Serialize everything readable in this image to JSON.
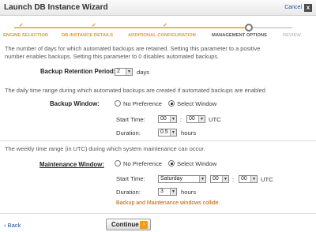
{
  "window": {
    "title": "Launch DB Instance Wizard",
    "cancel_label": "Cancel",
    "close_glyph": "x"
  },
  "steps": [
    {
      "label": "ENGINE SELECTION",
      "state": "done"
    },
    {
      "label": "DB INSTANCE DETAILS",
      "state": "done"
    },
    {
      "label": "ADDITIONAL CONFIGURATION",
      "state": "done"
    },
    {
      "label": "MANAGEMENT OPTIONS",
      "state": "current"
    },
    {
      "label": "REVIEW",
      "state": "upcoming"
    }
  ],
  "retention": {
    "description_line1": "The number of days for which automated backups are retained. Setting this parameter to a positive",
    "description_line2": "number enables backups. Setting this parameter to 0 disables automated backups.",
    "label": "Backup Retention Period:",
    "value": "2",
    "unit": "days"
  },
  "backup_window": {
    "description": "The daily time range during which automated backups are created if automated backups are enabled",
    "label": "Backup Window:",
    "option_no_pref": "No Preference",
    "option_select": "Select Window",
    "selected": "select",
    "start_time_label": "Start Time:",
    "start_hour": "00",
    "start_minute": "00",
    "time_sep": ":",
    "timezone": "UTC",
    "duration_label": "Duration:",
    "duration_value": "0.5",
    "duration_unit": "hours"
  },
  "maintenance_window": {
    "description": "The weekly time range (in UTC) during which system maintenance can occur.",
    "label": "Maintenance Window:",
    "option_no_pref": "No Preference",
    "option_select": "Select Window",
    "selected": "select",
    "start_time_label": "Start Time:",
    "start_day": "Saturday",
    "start_hour": "00",
    "start_minute": "00",
    "time_sep": ":",
    "timezone": "UTC",
    "duration_label": "Duration:",
    "duration_value": "3",
    "duration_unit": "hours",
    "warning": "Backup and Maintenance windows collide."
  },
  "footer": {
    "back_label": "Back",
    "back_glyph": "‹",
    "continue_label": "Continue",
    "continue_glyph": "›"
  },
  "colors": {
    "step_done": "#e79a2a",
    "link": "#1a4f9c",
    "warning": "#b45c00",
    "continue_icon": "#f39c12"
  }
}
